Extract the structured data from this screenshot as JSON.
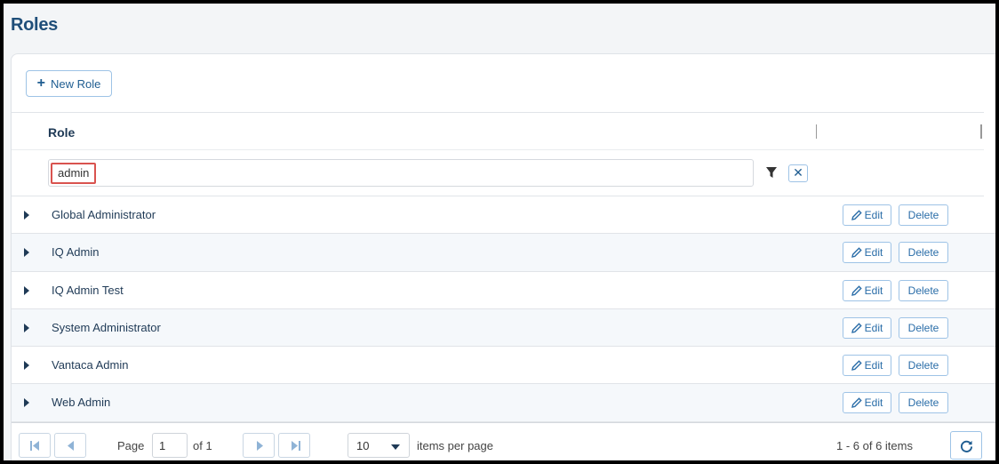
{
  "header": {
    "title": "Roles"
  },
  "toolbar": {
    "new_role_label": "New Role",
    "new_role_icon": "plus-icon"
  },
  "grid": {
    "column_role": "Role",
    "filter": {
      "value": "admin"
    },
    "rows": [
      {
        "label": "Global Administrator"
      },
      {
        "label": "IQ Admin"
      },
      {
        "label": "IQ Admin Test"
      },
      {
        "label": "System Administrator"
      },
      {
        "label": "Vantaca Admin"
      },
      {
        "label": "Web Admin"
      }
    ],
    "edit_label": "Edit",
    "delete_label": "Delete"
  },
  "pager": {
    "page_label": "Page",
    "current_page": "1",
    "of_label": "of 1",
    "per_page_value": "10",
    "per_page_label": "items per page",
    "summary": "1 - 6 of 6 items"
  },
  "colors": {
    "accent": "#1f5d91",
    "title": "#1f4e79",
    "highlight": "#d9534f"
  }
}
